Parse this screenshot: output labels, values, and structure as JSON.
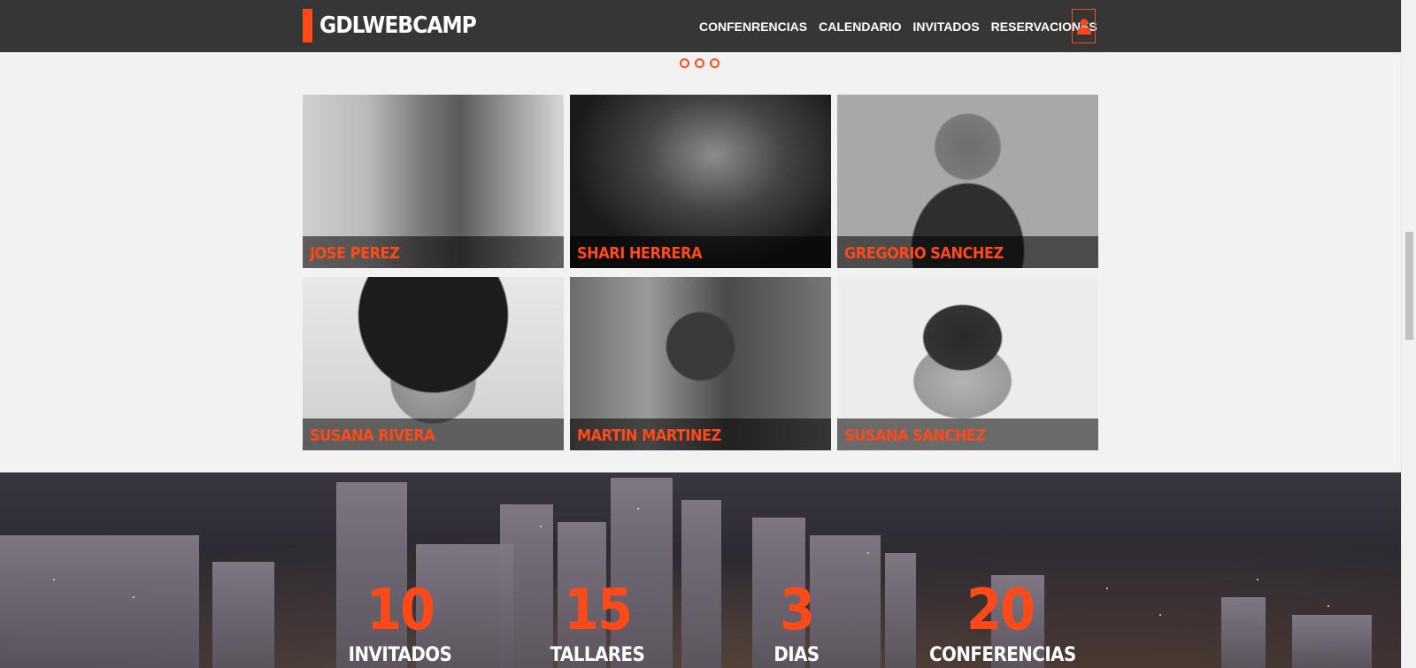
{
  "header": {
    "logo": "GDLWEBCAMP",
    "nav": [
      "CONFENRENCIAS",
      "CALENDARIO",
      "INVITADOS",
      "RESERVACIONES"
    ],
    "user_icon": "user-icon"
  },
  "colors": {
    "accent": "#fe4918",
    "header_bg": "#363636",
    "page_bg": "#f2f2f2"
  },
  "speakers": [
    {
      "name": "JOSE PEREZ"
    },
    {
      "name": "SHARI HERRERA"
    },
    {
      "name": "GREGORIO SANCHEZ"
    },
    {
      "name": "SUSANA RIVERA"
    },
    {
      "name": "MARTIN MARTINEZ"
    },
    {
      "name": "SUSANA SANCHEZ"
    }
  ],
  "stats": [
    {
      "value": "10",
      "label": "INVITADOS"
    },
    {
      "value": "15",
      "label": "TALLARES"
    },
    {
      "value": "3",
      "label": "DIAS"
    },
    {
      "value": "20",
      "label": "CONFERENCIAS"
    }
  ]
}
